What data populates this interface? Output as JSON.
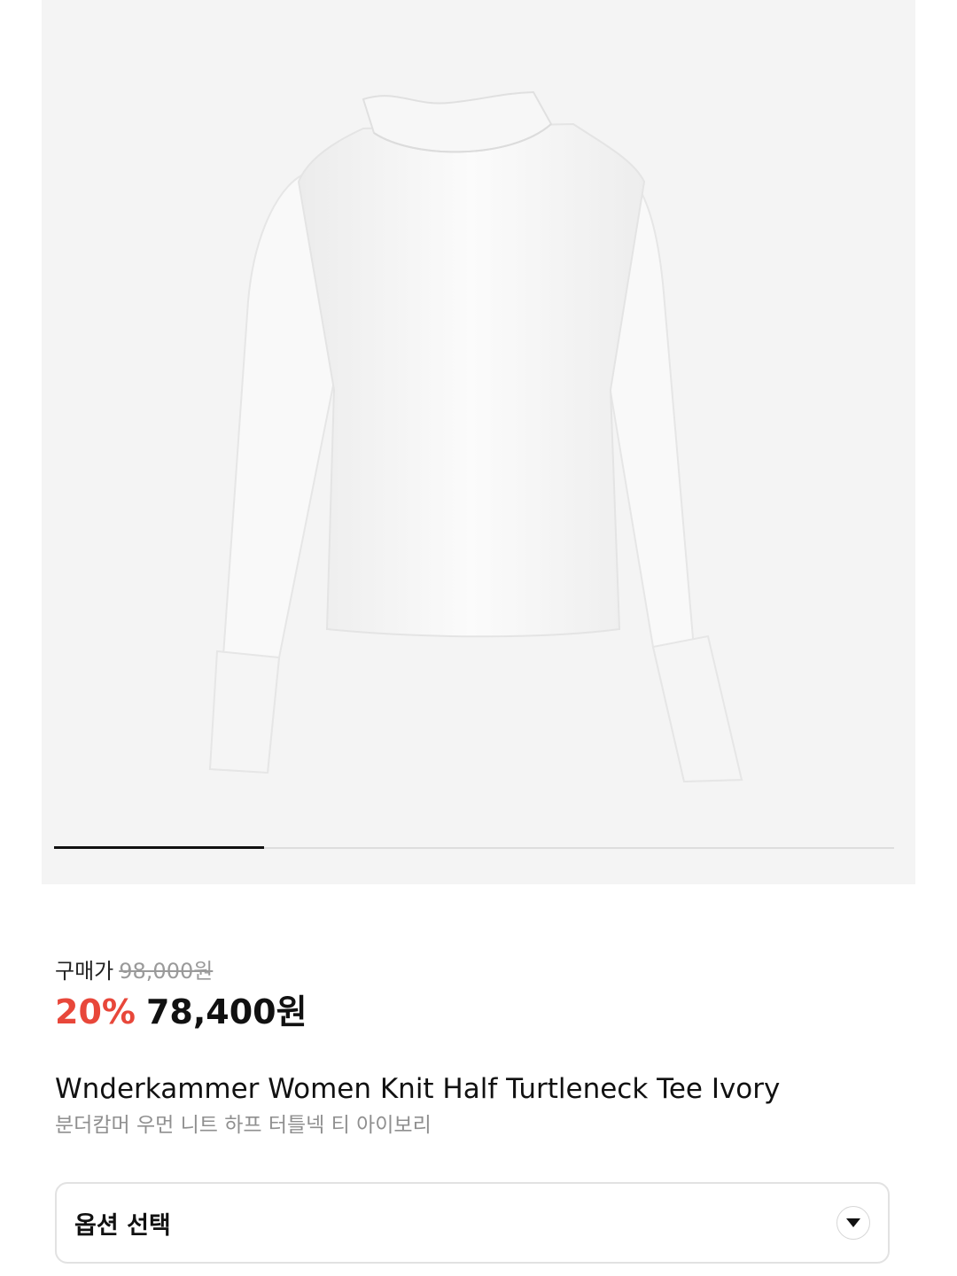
{
  "gallery": {
    "image_alt": "ivory knit half turtleneck tee",
    "progress": 0.25
  },
  "price": {
    "label": "구매가",
    "original": "98,000원",
    "discount": "20%",
    "sale": "78,400원"
  },
  "product": {
    "title_en": "Wnderkammer Women Knit Half Turtleneck Tee Ivory",
    "title_ko": "분더캄머 우먼 니트 하프 터틀넥 티 아이보리"
  },
  "option": {
    "label": "옵션 선택",
    "icon": "chevron-down-icon"
  },
  "colors": {
    "discount": "#e8473a",
    "gallery_bg": "#f4f4f4"
  }
}
